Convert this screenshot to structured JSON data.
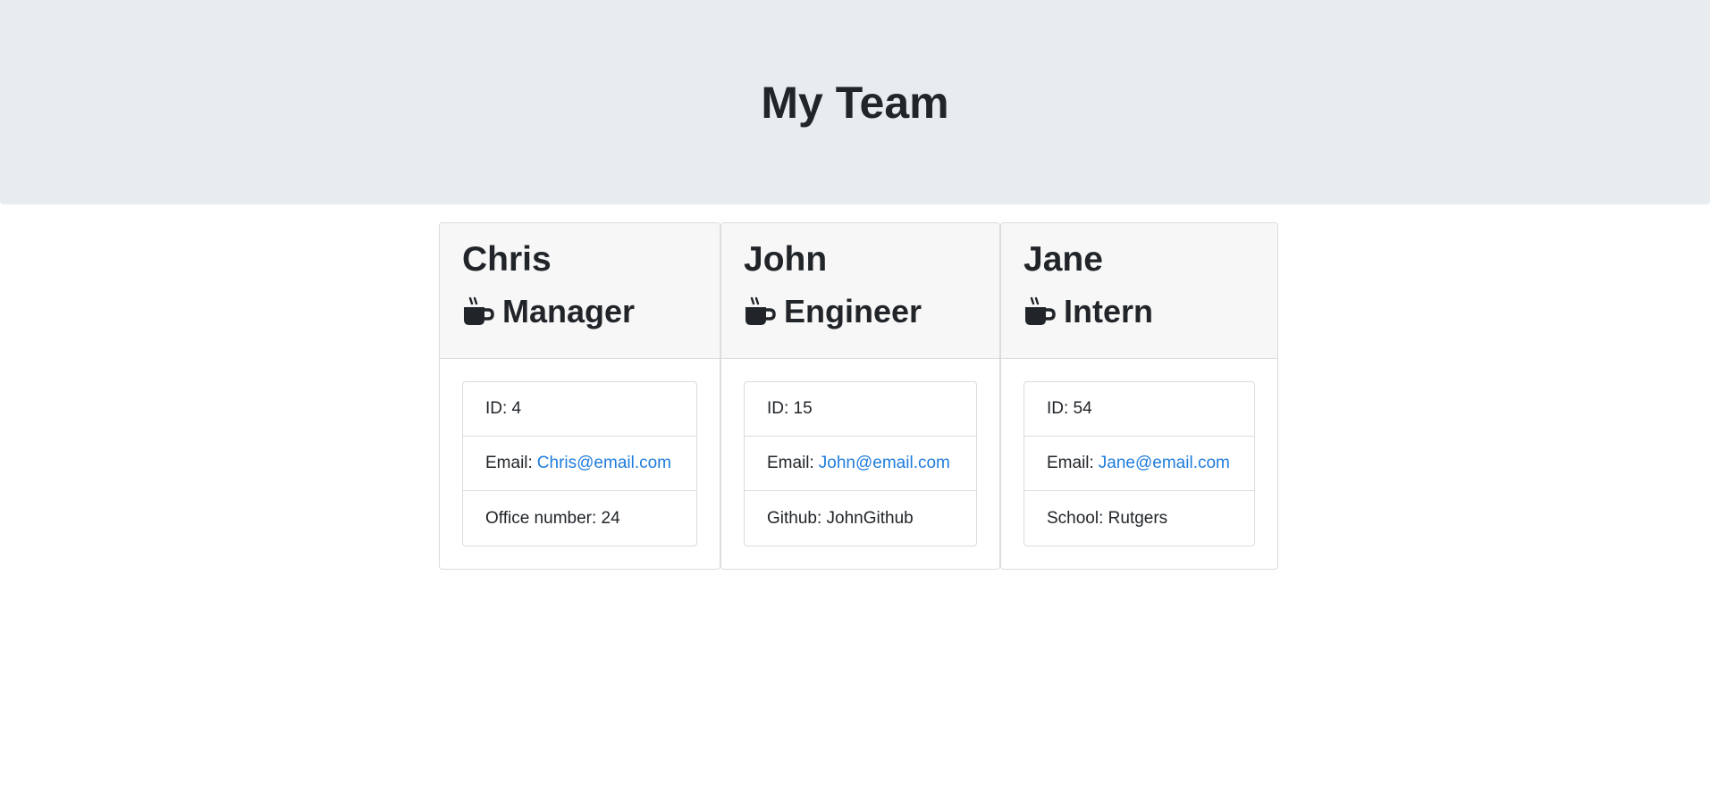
{
  "header": {
    "title": "My Team"
  },
  "team": [
    {
      "name": "Chris",
      "role": "Manager",
      "role_icon": "coffee-mug-icon",
      "id_text": "ID: 4",
      "email_label": "Email:",
      "email": "Chris@email.com",
      "extra": "Office number: 24"
    },
    {
      "name": "John",
      "role": "Engineer",
      "role_icon": "coffee-mug-icon",
      "id_text": "ID: 15",
      "email_label": "Email:",
      "email": "John@email.com",
      "extra": "Github: JohnGithub"
    },
    {
      "name": "Jane",
      "role": "Intern",
      "role_icon": "coffee-mug-icon",
      "id_text": "ID: 54",
      "email_label": "Email:",
      "email": "Jane@email.com",
      "extra": "School: Rutgers"
    }
  ],
  "colors": {
    "header_bg": "#e9ecef",
    "link": "#1f7cdb",
    "text": "#212529"
  }
}
